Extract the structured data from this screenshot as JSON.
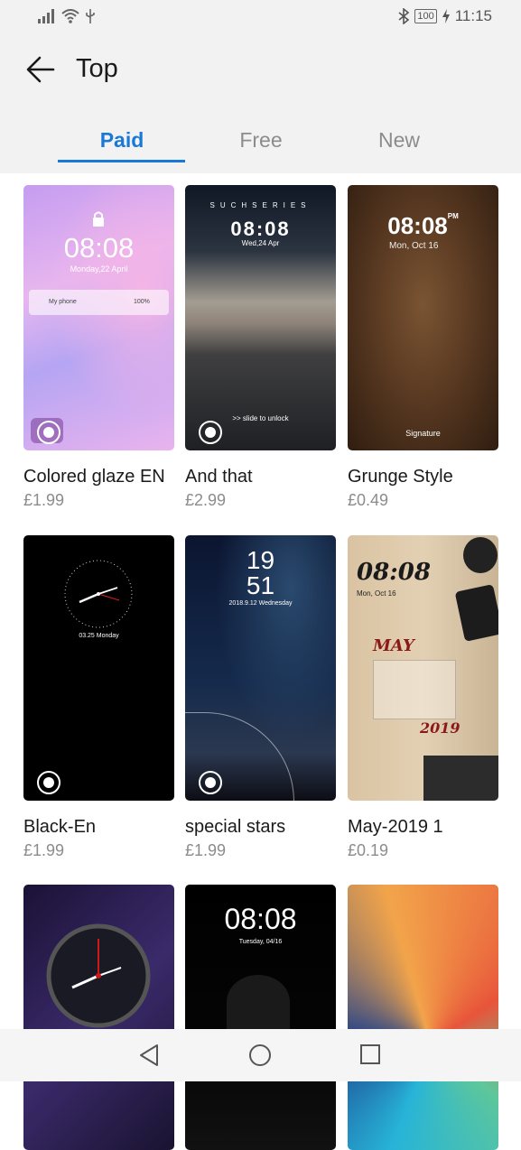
{
  "status": {
    "battery": "100",
    "time": "11:15"
  },
  "header": {
    "title": "Top"
  },
  "tabs": [
    {
      "label": "Paid"
    },
    {
      "label": "Free"
    },
    {
      "label": "New"
    }
  ],
  "themes": [
    {
      "name": "Colored glaze EN",
      "price": "£1.99",
      "time": "08:08",
      "date": "Monday,22 April",
      "notif": "My phone",
      "notif_pct": "100%"
    },
    {
      "name": "And that",
      "price": "£2.99",
      "brand": "SUCHSERIES",
      "time": "08:08",
      "date": "Wed,24 Apr",
      "unlock": ">> slide to unlock"
    },
    {
      "name": "Grunge Style",
      "price": "£0.49",
      "time": "08:08",
      "ampm": "PM",
      "date": "Mon, Oct 16",
      "signature": "Signature"
    },
    {
      "name": "Black-En",
      "price": "£1.99",
      "date": "03.25 Monday"
    },
    {
      "name": "special stars",
      "price": "£1.99",
      "hour": "19",
      "minute": "51",
      "date": "2018.9.12 Wednesday"
    },
    {
      "name": "May-2019 1",
      "price": "£0.19",
      "time": "08:08",
      "date": "Mon, Oct 16",
      "month": "MAY",
      "year": "2019"
    },
    {
      "name": "",
      "price": ""
    },
    {
      "name": "",
      "price": "",
      "time": "08:08",
      "date": "Tuesday, 04/16"
    },
    {
      "name": "",
      "price": ""
    }
  ]
}
